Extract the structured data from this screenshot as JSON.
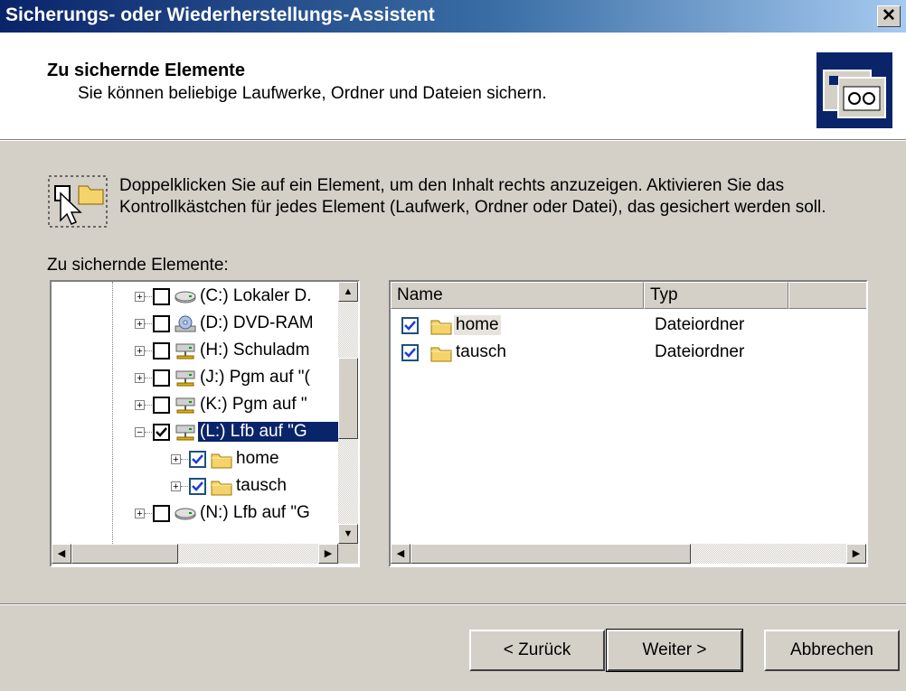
{
  "window": {
    "title": "Sicherungs- oder Wiederherstellungs-Assistent",
    "close_glyph": "✕"
  },
  "header": {
    "title": "Zu sichernde Elemente",
    "subtitle": "Sie können beliebige Laufwerke, Ordner und Dateien sichern.",
    "icon": "backup-wizard-icon"
  },
  "instructions": "Doppelklicken Sie auf ein Element, um den Inhalt rechts anzuzeigen. Aktivieren Sie das Kontrollkästchen für jedes Element (Laufwerk, Ordner oder Datei), das gesichert werden soll.",
  "items_label": "Zu sichernde Elemente:",
  "tree": [
    {
      "label": "(C:) Lokaler D.",
      "icon": "hard-drive-icon",
      "checked": false,
      "expander": "+",
      "level": 0
    },
    {
      "label": "(D:) DVD-RAM",
      "icon": "dvd-drive-icon",
      "checked": false,
      "expander": "+",
      "level": 0
    },
    {
      "label": "(H:) Schuladm",
      "icon": "network-drive-icon",
      "checked": false,
      "expander": "+",
      "level": 0
    },
    {
      "label": "(J:) Pgm auf \"(",
      "icon": "network-drive-icon",
      "checked": false,
      "expander": "+",
      "level": 0
    },
    {
      "label": "(K:) Pgm auf \"",
      "icon": "network-drive-icon",
      "checked": false,
      "expander": "+",
      "level": 0
    },
    {
      "label": "(L:) Lfb auf \"G",
      "icon": "network-drive-icon",
      "checked": true,
      "expander": "−",
      "level": 0,
      "selected": true
    },
    {
      "label": "home",
      "icon": "folder-icon",
      "checked": true,
      "expander": "+",
      "level": 1
    },
    {
      "label": "tausch",
      "icon": "folder-icon",
      "checked": true,
      "expander": "+",
      "level": 1
    },
    {
      "label": "(N:) Lfb auf \"G",
      "icon": "hard-drive-icon",
      "checked": false,
      "expander": "+",
      "level": 0
    }
  ],
  "list": {
    "columns": [
      "Name",
      "Typ"
    ],
    "rows": [
      {
        "name": "home",
        "type": "Dateiordner",
        "checked": true,
        "icon": "folder-icon"
      },
      {
        "name": "tausch",
        "type": "Dateiordner",
        "checked": true,
        "icon": "folder-icon"
      }
    ]
  },
  "buttons": {
    "back": "< Zurück",
    "next": "Weiter >",
    "cancel": "Abbrechen"
  },
  "colors": {
    "title_start": "#0a246a",
    "title_end": "#a6caf0",
    "selection": "#0a246a",
    "face": "#d4d0c8",
    "folder": "#f5d36b"
  }
}
